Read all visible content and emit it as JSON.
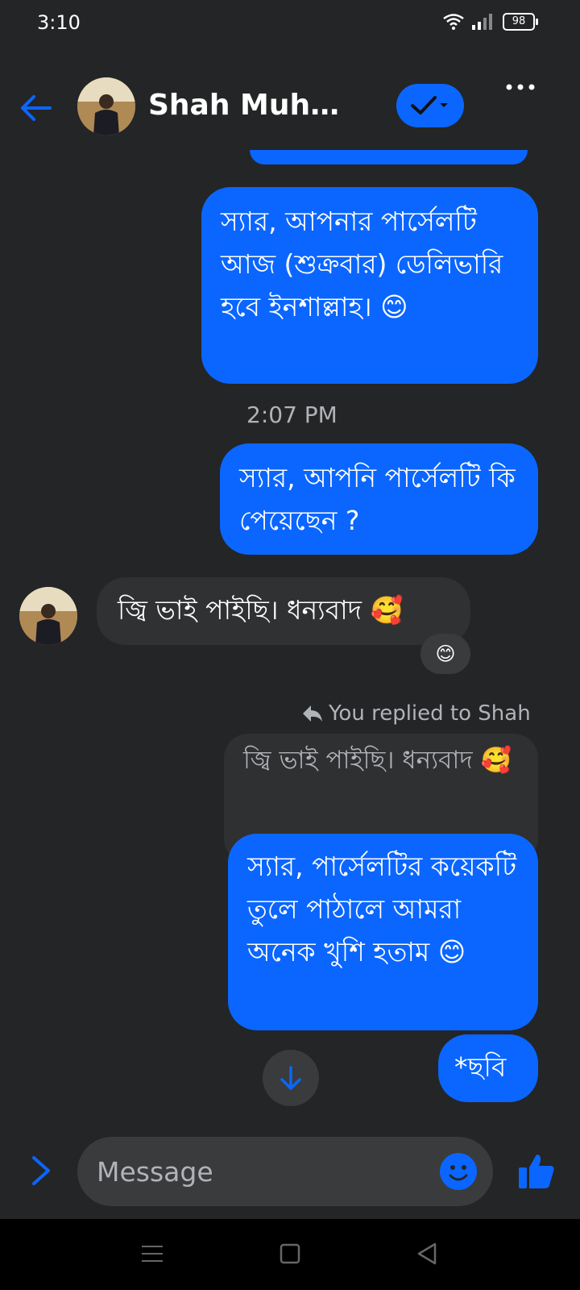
{
  "status_bar": {
    "time": "3:10",
    "battery": "98",
    "icons": [
      "wifi-icon",
      "signal-icon",
      "battery-icon"
    ]
  },
  "header": {
    "contact_name": "Shah Muham...",
    "back_icon": "arrow-left-icon",
    "verify_icon": "check-dropdown-icon",
    "more_icon": "more-dots-icon"
  },
  "messages": {
    "m1": "স্যার, আপনার পার্সেলটি আজ (শুক্রবার) ডেলিভারি হবে ইনশাল্লাহ। 😊",
    "timestamp": "2:07 PM",
    "m2": "স্যার, আপনি পার্সেলটি কি পেয়েছেন ?",
    "m3": "জ্বি ভাই পাইছি। ধন্যবাদ 🥰",
    "m3_reaction": "😊",
    "reply_label": "You replied to Shah",
    "quoted": "জ্বি ভাই পাইছি। ধন্যবাদ 🥰",
    "m4": "স্যার, পার্সেলটির কয়েকটি তুলে পাঠালে আমরা অনেক খুশি হতাম 😊",
    "m5": "*ছবি"
  },
  "composer": {
    "placeholder": "Message"
  },
  "colors": {
    "background": "#242526",
    "accent": "#0a66ff",
    "incoming_bubble": "#303132",
    "muted_text": "#b0b3b8"
  }
}
